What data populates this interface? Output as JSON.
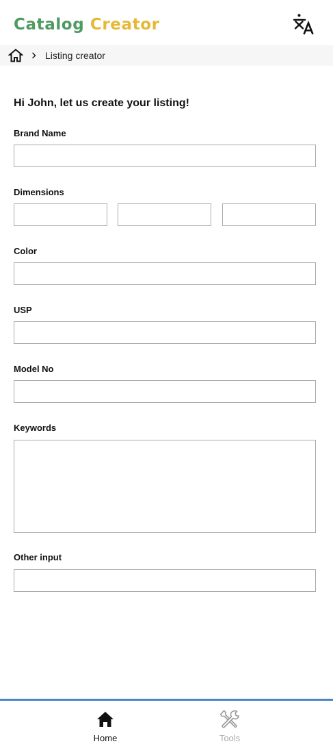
{
  "header": {
    "logo_part_1": "Catalog",
    "logo_part_2": "Creator",
    "logo_color_1": "#4e9a62",
    "logo_color_2": "#e6b833",
    "translate_icon": "translate-icon"
  },
  "breadcrumb": {
    "home_icon": "home-outline-icon",
    "separator_icon": "chevron-right-icon",
    "current": "Listing creator"
  },
  "form": {
    "heading": "Hi John, let us create your listing!",
    "brand_name": {
      "label": "Brand Name",
      "value": ""
    },
    "dimensions": {
      "label": "Dimensions",
      "values": [
        "",
        "",
        ""
      ]
    },
    "color": {
      "label": "Color",
      "value": ""
    },
    "usp": {
      "label": "USP",
      "value": ""
    },
    "model_no": {
      "label": "Model No",
      "value": ""
    },
    "keywords": {
      "label": "Keywords",
      "value": ""
    },
    "other_input": {
      "label": "Other input",
      "value": ""
    }
  },
  "bottom_nav": {
    "accent_color": "#4a86c8",
    "items": [
      {
        "label": "Home",
        "icon": "home-filled-icon",
        "active": true
      },
      {
        "label": "Tools",
        "icon": "tools-icon",
        "active": false
      }
    ]
  }
}
